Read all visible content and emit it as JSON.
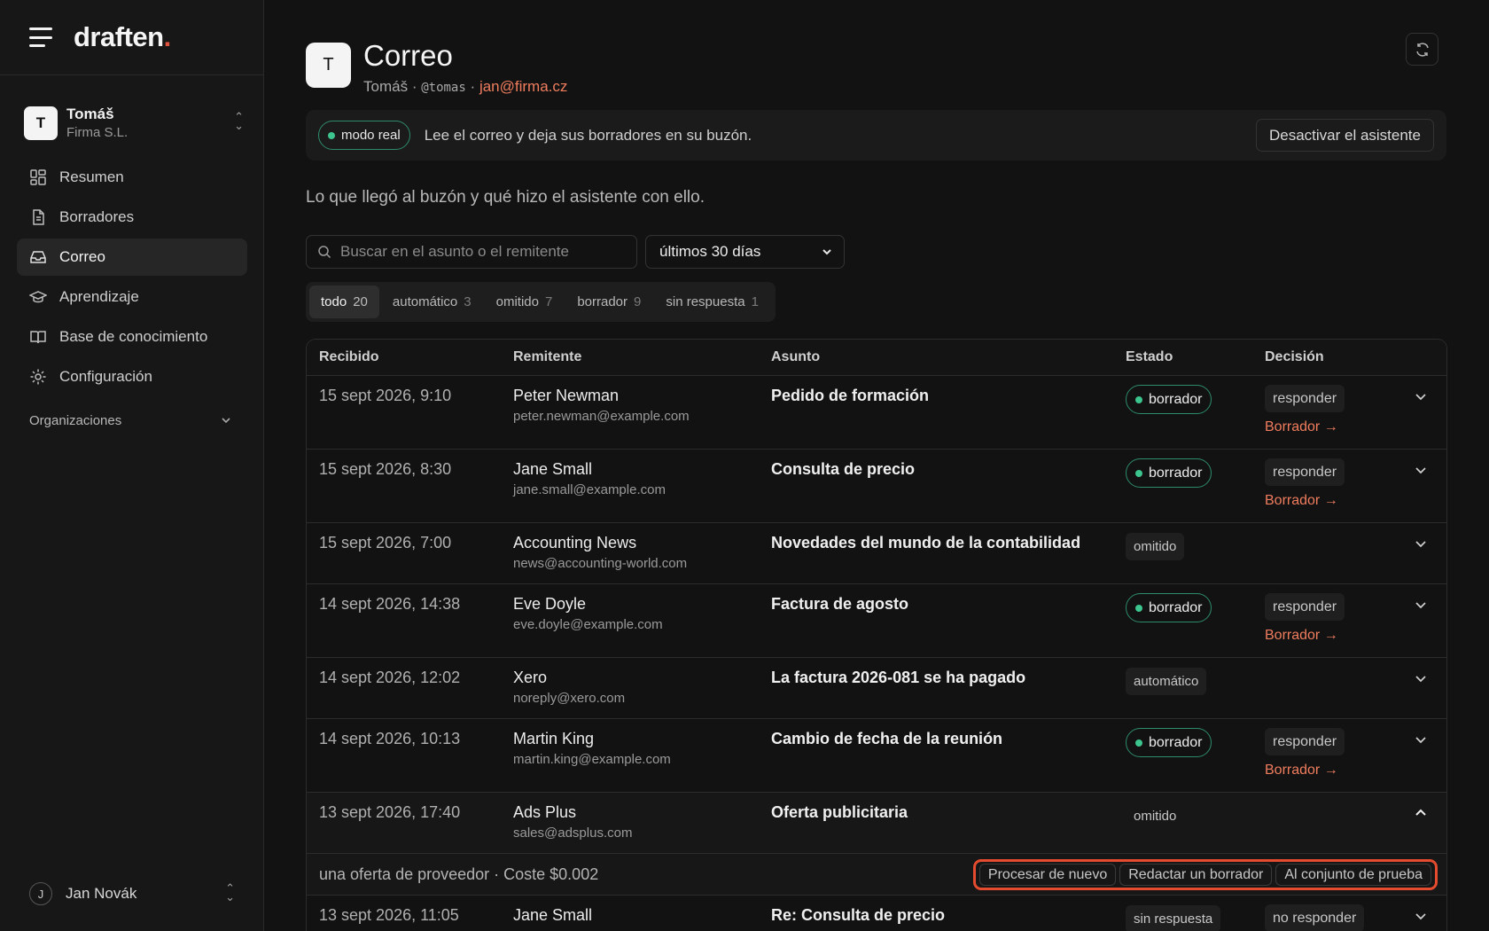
{
  "brand": {
    "logo_text": "draften",
    "logo_dot": ".",
    "accent": "#e0533f"
  },
  "org": {
    "avatar": "T",
    "name": "Tomáš",
    "company": "Firma S.L."
  },
  "nav": {
    "items": [
      {
        "label": "Resumen",
        "icon": "dashboard-icon"
      },
      {
        "label": "Borradores",
        "icon": "document-icon"
      },
      {
        "label": "Correo",
        "icon": "inbox-icon",
        "active": true
      },
      {
        "label": "Aprendizaje",
        "icon": "graduation-cap-icon"
      },
      {
        "label": "Base de conocimiento",
        "icon": "book-icon"
      },
      {
        "label": "Configuración",
        "icon": "gear-icon"
      }
    ],
    "section_label": "Organizaciones"
  },
  "user": {
    "avatar": "J",
    "name": "Jan Novák"
  },
  "header": {
    "avatar": "T",
    "title": "Correo",
    "name": "Tomáš",
    "sep": "·",
    "handle": "@tomas",
    "email": "jan@firma.cz"
  },
  "banner": {
    "mode_label": "modo real",
    "text": "Lee el correo y deja sus borradores en su buzón.",
    "deactivate_label": "Desactivar el asistente"
  },
  "intro": "Lo que llegó al buzón y qué hizo el asistente con ello.",
  "search": {
    "placeholder": "Buscar en el asunto o el remitente",
    "value": ""
  },
  "range": {
    "selected": "últimos 30 días"
  },
  "filters": [
    {
      "label": "todo",
      "count": "20",
      "active": true
    },
    {
      "label": "automático",
      "count": "3"
    },
    {
      "label": "omitido",
      "count": "7"
    },
    {
      "label": "borrador",
      "count": "9"
    },
    {
      "label": "sin respuesta",
      "count": "1"
    }
  ],
  "table": {
    "columns": {
      "date": "Recibido",
      "from": "Remitente",
      "subject": "Asunto",
      "state": "Estado",
      "decision": "Decisión"
    },
    "rows": [
      {
        "date": "15 sept 2026, 9:10",
        "name": "Peter Newman",
        "email": "peter.newman@example.com",
        "subject": "Pedido de formación",
        "state": "borrador",
        "decision": "responder",
        "link": "Borrador →"
      },
      {
        "date": "15 sept 2026, 8:30",
        "name": "Jane Small",
        "email": "jane.small@example.com",
        "subject": "Consulta de precio",
        "state": "borrador",
        "decision": "responder",
        "link": "Borrador →"
      },
      {
        "date": "15 sept 2026, 7:00",
        "name": "Accounting News",
        "email": "news@accounting-world.com",
        "subject": "Novedades del mundo de la contabilidad",
        "state": "omitido"
      },
      {
        "date": "14 sept 2026, 14:38",
        "name": "Eve Doyle",
        "email": "eve.doyle@example.com",
        "subject": "Factura de agosto",
        "state": "borrador",
        "decision": "responder",
        "link": "Borrador →"
      },
      {
        "date": "14 sept 2026, 12:02",
        "name": "Xero",
        "email": "noreply@xero.com",
        "subject": "La factura 2026-081 se ha pagado",
        "state": "automático"
      },
      {
        "date": "14 sept 2026, 10:13",
        "name": "Martin King",
        "email": "martin.king@example.com",
        "subject": "Cambio de fecha de la reunión",
        "state": "borrador",
        "decision": "responder",
        "link": "Borrador →"
      },
      {
        "date": "13 sept 2026, 17:40",
        "name": "Ads Plus",
        "email": "sales@adsplus.com",
        "subject": "Oferta publicitaria",
        "state": "omitido",
        "expanded": true
      },
      {
        "date": "13 sept 2026, 11:05",
        "name": "Jane Small",
        "email": "",
        "subject": "Re: Consulta de precio",
        "state": "sin respuesta",
        "decision": "no responder"
      }
    ],
    "detail": {
      "info": "una oferta de proveedor · Coste $0.002",
      "actions": [
        "Procesar de nuevo",
        "Redactar un borrador",
        "Al conjunto de prueba"
      ]
    }
  }
}
